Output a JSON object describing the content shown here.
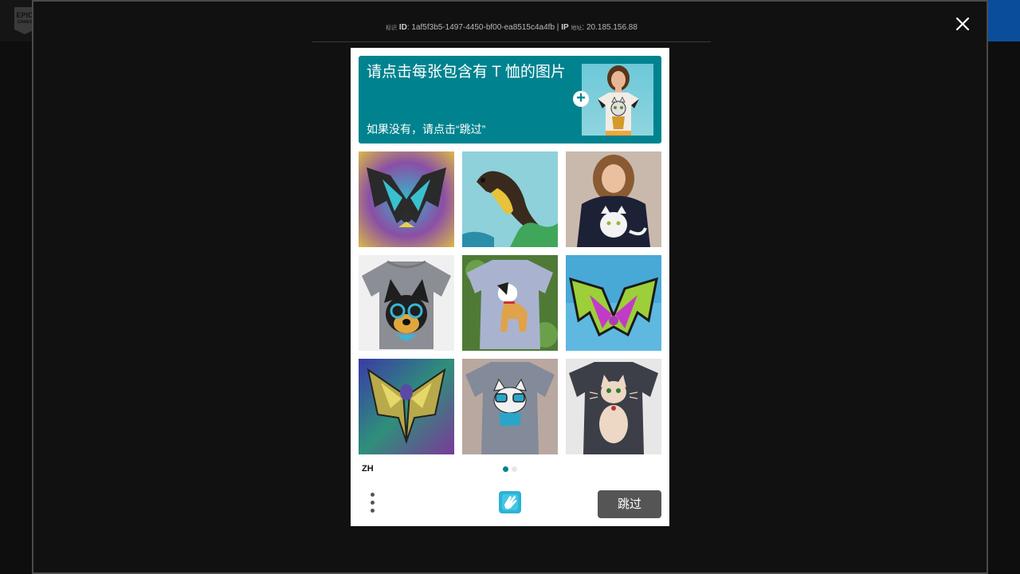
{
  "background": {
    "logo_text": "EPIC",
    "logo_subtext": "GAMES"
  },
  "overlay": {
    "meta": {
      "id_prefix": "标识",
      "id_label": "ID",
      "id_value": "1af5f3b5-1497-4450-bf00-ea8515c4a4fb",
      "separator": "|",
      "ip_label": "IP",
      "ip_suffix": "地址",
      "ip_value": "20.185.156.88"
    },
    "close_icon": "close-icon"
  },
  "challenge": {
    "prompt_title": "请点击每张包含有 T 恤的图片",
    "prompt_subtitle": "如果没有，请点击“跳过”",
    "example_image": "t-shirt-woman-cat-print",
    "plus_icon": "plus-circle-icon",
    "tiles": [
      {
        "name": "tile-bat-nebula",
        "subject": "bat artwork on nebula background"
      },
      {
        "name": "tile-otter",
        "subject": "otter artwork on blue background"
      },
      {
        "name": "tile-woman-cat-sweater",
        "subject": "woman wearing navy top with cat print"
      },
      {
        "name": "tile-grey-tshirt-dog-glasses",
        "subject": "grey t-shirt with dog in glasses print"
      },
      {
        "name": "tile-grey-tshirt-dog",
        "subject": "grey t-shirt with dog print"
      },
      {
        "name": "tile-bat-purple",
        "subject": "purple bat artwork on blue background"
      },
      {
        "name": "tile-moth-art",
        "subject": "moth artwork on aurora background"
      },
      {
        "name": "tile-grey-tshirt-cat",
        "subject": "grey t-shirt with cat in glasses print"
      },
      {
        "name": "tile-dark-tshirt-cat",
        "subject": "dark t-shirt with cat print"
      }
    ],
    "language": "ZH",
    "page_index": 1,
    "page_count": 2,
    "menu_icon": "more-vertical-icon",
    "brand_icon": "hcaptcha-hand-icon",
    "submit_label": "跳过"
  },
  "colors": {
    "accent": "#00838f",
    "submit_bg": "#555555",
    "overlay_border": "#4a4a4a",
    "bg_blue": "#0a4e9b"
  }
}
